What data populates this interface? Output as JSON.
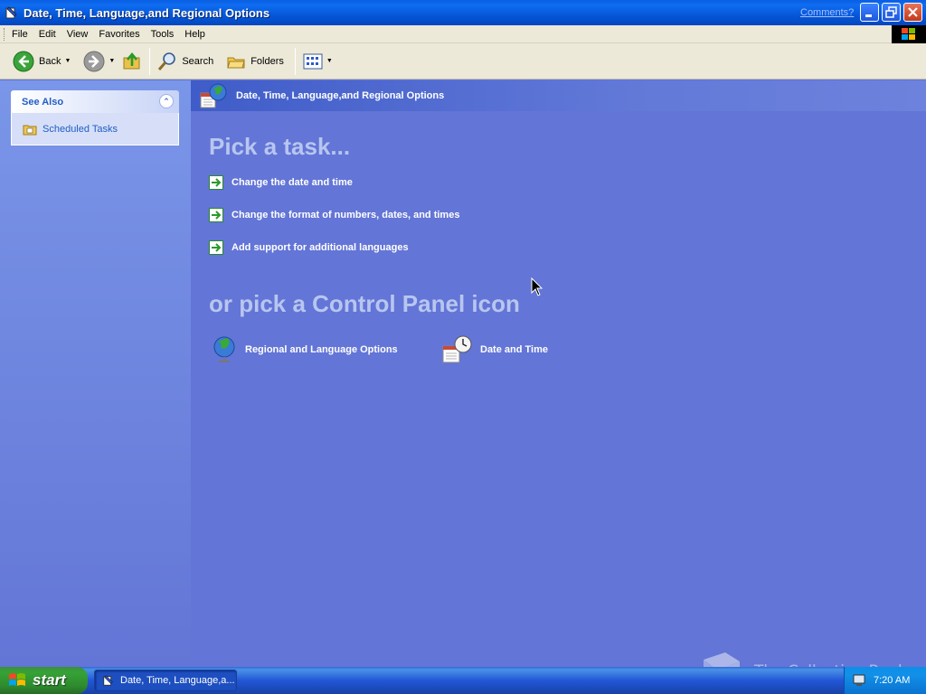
{
  "window": {
    "title": "Date, Time, Language,and Regional Options",
    "comments_link": "Comments?"
  },
  "menubar": {
    "items": [
      "File",
      "Edit",
      "View",
      "Favorites",
      "Tools",
      "Help"
    ]
  },
  "toolbar": {
    "back_label": "Back",
    "search_label": "Search",
    "folders_label": "Folders"
  },
  "see_also": {
    "title": "See Also",
    "items": [
      {
        "label": "Scheduled Tasks",
        "icon": "scheduled-tasks-icon"
      }
    ]
  },
  "main": {
    "header_title": "Date, Time, Language,and Regional Options",
    "pick_task_title": "Pick a task...",
    "tasks": [
      "Change the date and time",
      "Change the format of numbers, dates, and times",
      "Add support for additional languages"
    ],
    "pick_icon_title": "or pick a Control Panel icon",
    "icons": [
      {
        "label": "Regional and Language Options",
        "icon": "globe-icon"
      },
      {
        "label": "Date and Time",
        "icon": "calendar-clock-icon"
      }
    ]
  },
  "taskbar": {
    "start_label": "start",
    "active_task": "Date, Time, Language,a...",
    "clock": "7:20 AM"
  },
  "watermark": {
    "text": "The Collection Book"
  },
  "colors": {
    "desktop_blue": "#6375d6",
    "title_blue": "#0558d8",
    "start_green": "#36a336",
    "link_blue": "#215dc6"
  }
}
